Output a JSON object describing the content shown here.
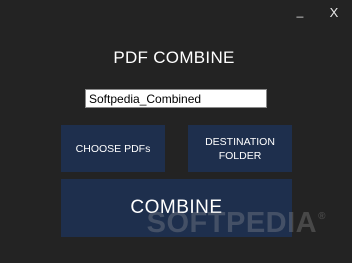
{
  "window": {
    "minimize_label": "_",
    "close_label": "X"
  },
  "header": {
    "title": "PDF COMBINE"
  },
  "form": {
    "output_name_value": "Softpedia_Combined"
  },
  "buttons": {
    "choose_label": "CHOOSE PDFs",
    "destination_label": "DESTINATION\nFOLDER",
    "combine_label": "COMBINE"
  },
  "watermark": {
    "text": "SOFTPEDIA",
    "mark": "®"
  },
  "colors": {
    "background": "#232323",
    "button": "#1e2f4d",
    "text": "#ffffff"
  }
}
